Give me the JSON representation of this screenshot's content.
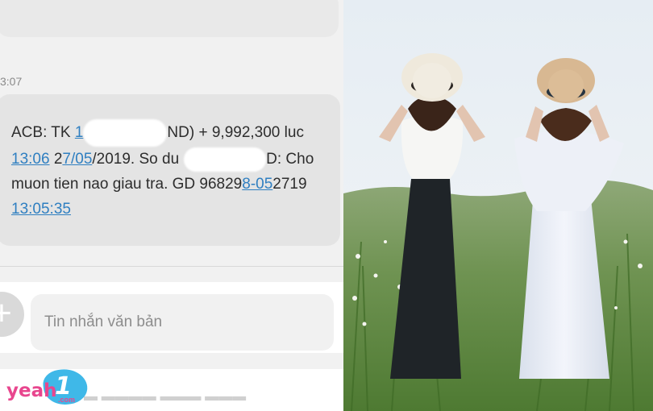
{
  "sms": {
    "timestamp": "3:07",
    "message": {
      "line1_prefix": "ACB: TK ",
      "line1_link": "1",
      "line1_after_redact": "ND) + 9,992,300 luc",
      "line2_time": "13:06",
      "line2_date_plain": " 2",
      "line2_date_link": "7/05",
      "line2_rest": "/2019. So du",
      "line2_after_redact": "D: Cho",
      "line3_prefix": "muon tien nao giau tra.  GD 96829",
      "line3_link1": "8-05",
      "line3_rest": "2719",
      "line4_link": "13:05:35"
    },
    "input_placeholder": "Tin nhắn văn bản",
    "plus_glyph": "+"
  },
  "watermark": {
    "word": "yeah",
    "number": "1",
    "suffix": ".com"
  },
  "colors": {
    "link": "#2f7fc1",
    "bubble": "#e4e4e4",
    "logo_pink": "#e8468e",
    "logo_blue": "#3fb8e8"
  }
}
